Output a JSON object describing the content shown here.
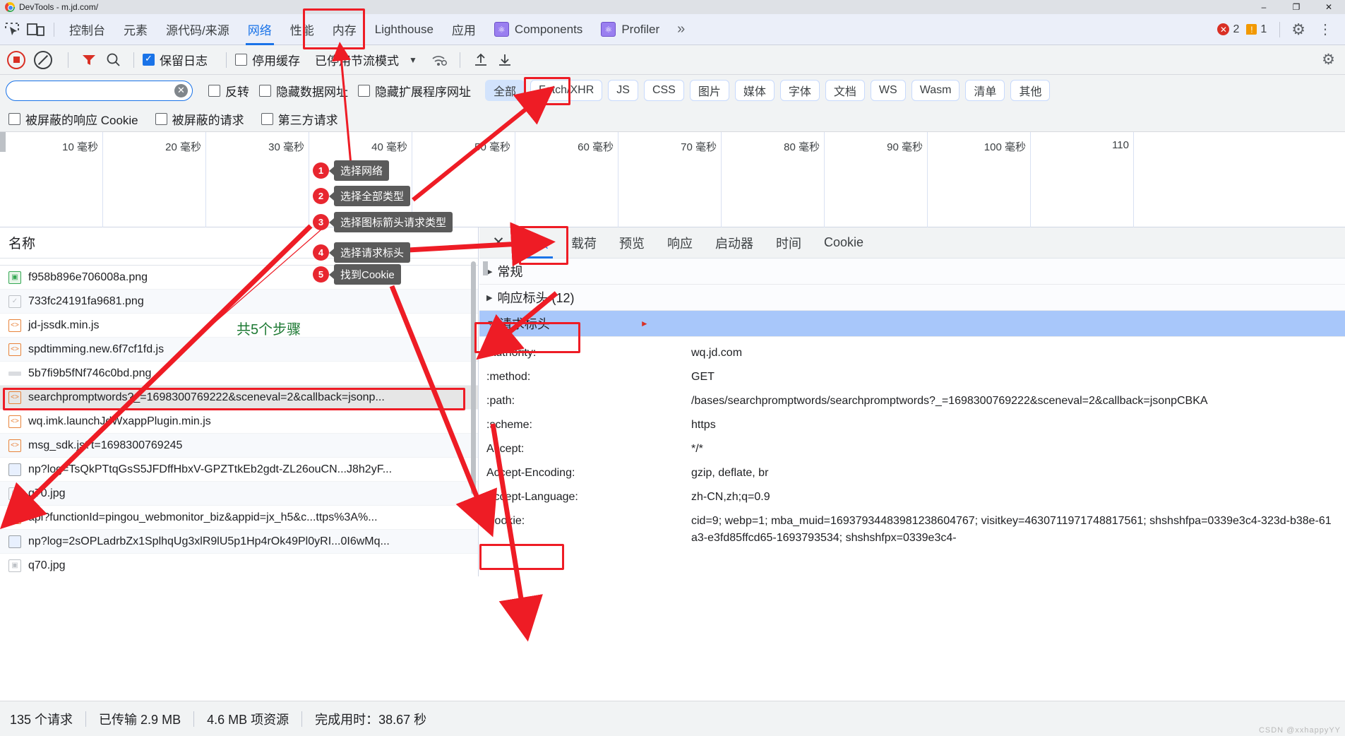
{
  "titlebar": {
    "title": "DevTools - m.jd.com/",
    "minimize": "–",
    "maximize": "❐",
    "close": "✕"
  },
  "tabstrip": {
    "inspect_icon": "inspect-element-icon",
    "device_icon": "device-toolbar-icon",
    "tabs": [
      {
        "label": "控制台",
        "active": false
      },
      {
        "label": "元素",
        "active": false
      },
      {
        "label": "源代码/来源",
        "active": false
      },
      {
        "label": "网络",
        "active": true
      },
      {
        "label": "性能",
        "active": false
      },
      {
        "label": "内存",
        "active": false
      },
      {
        "label": "Lighthouse",
        "active": false
      },
      {
        "label": "应用",
        "active": false
      },
      {
        "label": "Components",
        "active": false,
        "icon": "react-components-icon"
      },
      {
        "label": "Profiler",
        "active": false,
        "icon": "react-profiler-icon"
      }
    ],
    "more_tabs": "»",
    "error_count": "2",
    "warning_count": "1",
    "error_glyph": "✕",
    "warning_glyph": "!",
    "settings_glyph": "⚙",
    "menu_glyph": "⋮"
  },
  "network_toolbar": {
    "record_label": "record-button",
    "clear_label": "clear-button",
    "filter_label": "filter-icon",
    "search_label": "search-icon",
    "preserve_log": {
      "label": "保留日志",
      "checked": true
    },
    "disable_cache": {
      "label": "停用缓存",
      "checked": false
    },
    "throttling": {
      "label": "已停用节流模式",
      "caret": "▼"
    },
    "wifi_glyph": "◴",
    "import_glyph": "↑",
    "export_glyph": "↓",
    "settings_glyph": "⚙"
  },
  "filter_row": {
    "search_value": "",
    "search_placeholder": "",
    "clear_glyph": "✕",
    "invert": {
      "label": "反转",
      "checked": false
    },
    "hide_data_urls": {
      "label": "隐藏数据网址",
      "checked": false
    },
    "hide_ext_urls": {
      "label": "隐藏扩展程序网址",
      "checked": false
    },
    "type_pills": [
      {
        "label": "全部",
        "selected": true
      },
      {
        "label": "Fetch/XHR",
        "selected": false
      },
      {
        "label": "JS",
        "selected": false
      },
      {
        "label": "CSS",
        "selected": false
      },
      {
        "label": "图片",
        "selected": false
      },
      {
        "label": "媒体",
        "selected": false
      },
      {
        "label": "字体",
        "selected": false
      },
      {
        "label": "文档",
        "selected": false
      },
      {
        "label": "WS",
        "selected": false
      },
      {
        "label": "Wasm",
        "selected": false
      },
      {
        "label": "清单",
        "selected": false
      },
      {
        "label": "其他",
        "selected": false
      }
    ]
  },
  "third_row": {
    "blocked_cookies": {
      "label": "被屏蔽的响应 Cookie",
      "checked": false
    },
    "blocked_requests": {
      "label": "被屏蔽的请求",
      "checked": false
    },
    "third_party": {
      "label": "第三方请求",
      "checked": false
    }
  },
  "overview": {
    "ticks": [
      "10 毫秒",
      "20 毫秒",
      "30 毫秒",
      "40 毫秒",
      "50 毫秒",
      "60 毫秒",
      "70 毫秒",
      "80 毫秒",
      "90 毫秒",
      "100 毫秒",
      "110"
    ]
  },
  "request_list": {
    "column_header": "名称",
    "rows": [
      {
        "name": "f958b896e706008a.png",
        "icon": "image-green-icon",
        "selected": false
      },
      {
        "name": "733fc24191fa9681.png",
        "icon": "image-gray-icon",
        "selected": false
      },
      {
        "name": "jd-jssdk.min.js",
        "icon": "script-icon",
        "selected": false
      },
      {
        "name": "spdtimming.new.6f7cf1fd.js",
        "icon": "script-icon",
        "selected": false
      },
      {
        "name": "5b7fi9b5fNf746c0bd.png",
        "icon": "other-icon",
        "selected": false
      },
      {
        "name": "searchpromptwords?_=1698300769222&sceneval=2&callback=jsonp...",
        "icon": "script-icon",
        "selected": true
      },
      {
        "name": "wq.imk.launchJdWxappPlugin.min.js",
        "icon": "script-icon",
        "selected": false
      },
      {
        "name": "msg_sdk.js?t=1698300769245",
        "icon": "script-icon",
        "selected": false
      },
      {
        "name": "np?log=TsQkPTtqGsS5JFDffHbxV-GPZTtkEb2gdt-ZL26ouCN...J8h2yF...",
        "icon": "doc-icon",
        "selected": false
      },
      {
        "name": "q70.jpg",
        "icon": "image-gray-icon",
        "selected": false
      },
      {
        "name": "api?functionId=pingou_webmonitor_biz&appid=jx_h5&c...ttps%3A%...",
        "icon": "script-icon",
        "selected": false
      },
      {
        "name": "np?log=2sOPLadrbZx1SplhqUg3xlR9lU5p1Hp4rOk49Pl0yRI...0I6wMq...",
        "icon": "doc-icon",
        "selected": false
      },
      {
        "name": "q70.jpg",
        "icon": "image-gray-icon",
        "selected": false
      }
    ]
  },
  "details": {
    "close_glyph": "✕",
    "tabs": [
      {
        "label": "标头",
        "active": true
      },
      {
        "label": "载荷",
        "active": false
      },
      {
        "label": "预览",
        "active": false
      },
      {
        "label": "响应",
        "active": false
      },
      {
        "label": "启动器",
        "active": false
      },
      {
        "label": "时间",
        "active": false
      },
      {
        "label": "Cookie",
        "active": false
      }
    ],
    "sections": [
      {
        "label": "常规",
        "expanded": false,
        "tri": "▶",
        "highlighted": false
      },
      {
        "label": "响应标头 (12)",
        "expanded": false,
        "tri": "▶",
        "highlighted": false
      },
      {
        "label": "请求标头",
        "expanded": true,
        "tri": "▼",
        "highlighted": true
      }
    ],
    "request_headers": [
      {
        "key": ":authority:",
        "value": "wq.jd.com"
      },
      {
        "key": ":method:",
        "value": "GET"
      },
      {
        "key": ":path:",
        "value": "/bases/searchpromptwords/searchpromptwords?_=1698300769222&sceneval=2&callback=jsonpCBKA"
      },
      {
        "key": ":scheme:",
        "value": "https"
      },
      {
        "key": "Accept:",
        "value": "*/*"
      },
      {
        "key": "Accept-Encoding:",
        "value": "gzip, deflate, br"
      },
      {
        "key": "Accept-Language:",
        "value": "zh-CN,zh;q=0.9"
      },
      {
        "key": "Cookie:",
        "value": "cid=9; webp=1; mba_muid=16937934483981238604767; visitkey=4630711971748817561; shshshfpa=0339e3c4-323d-b38e-61a3-e3fd85ffcd65-1693793534; shshshfpx=0339e3c4-"
      }
    ]
  },
  "statusbar": {
    "requests": "135 个请求",
    "transferred": "已传输 2.9 MB",
    "resources": "4.6 MB 项资源",
    "finish": "完成用时：38.67 秒"
  },
  "annotations": {
    "steps_note": "共5个步骤",
    "callouts": [
      {
        "num": "1",
        "text": "选择网络"
      },
      {
        "num": "2",
        "text": "选择全部类型"
      },
      {
        "num": "3",
        "text": "选择图标箭头请求类型"
      },
      {
        "num": "4",
        "text": "选择请求标头"
      },
      {
        "num": "5",
        "text": "找到Cookie"
      }
    ],
    "highlight_color": "#ee1c25"
  },
  "watermark": "CSDN @xxhappyYY"
}
